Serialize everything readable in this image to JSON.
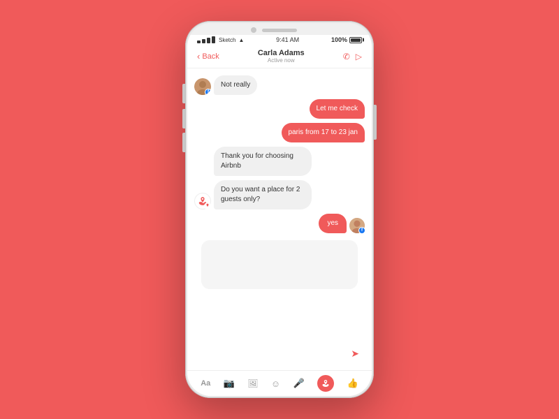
{
  "background_color": "#F05A5A",
  "phone": {
    "status_bar": {
      "signal": "●●●●",
      "carrier": "Sketch",
      "wifi": "▲",
      "time": "9:41 AM",
      "battery": "100%"
    },
    "nav": {
      "back_label": "Back",
      "contact_name": "Carla Adams",
      "contact_status": "Active now"
    },
    "messages": [
      {
        "id": "msg1",
        "type": "received",
        "avatar": "person",
        "badge": "facebook",
        "text": "Not really"
      },
      {
        "id": "msg2",
        "type": "sent",
        "text": "Let me check"
      },
      {
        "id": "msg3",
        "type": "sent",
        "text": "paris from 17 to 23 jan"
      },
      {
        "id": "msg4",
        "type": "received",
        "avatar": "none",
        "text": "Thank you for choosing Airbnb"
      },
      {
        "id": "msg5",
        "type": "received",
        "avatar": "airbnb",
        "badge": "airbnb",
        "text": "Do you want a place for 2 guests only?"
      },
      {
        "id": "msg6",
        "type": "sent",
        "text": "yes",
        "show_avatar": true
      }
    ],
    "toolbar": {
      "text_icon": "Aa",
      "camera_icon": "📷",
      "gallery_icon": "🖼",
      "emoji_icon": "☺",
      "mic_icon": "🎤",
      "airbnb_icon": "✦",
      "like_icon": "👍"
    }
  }
}
